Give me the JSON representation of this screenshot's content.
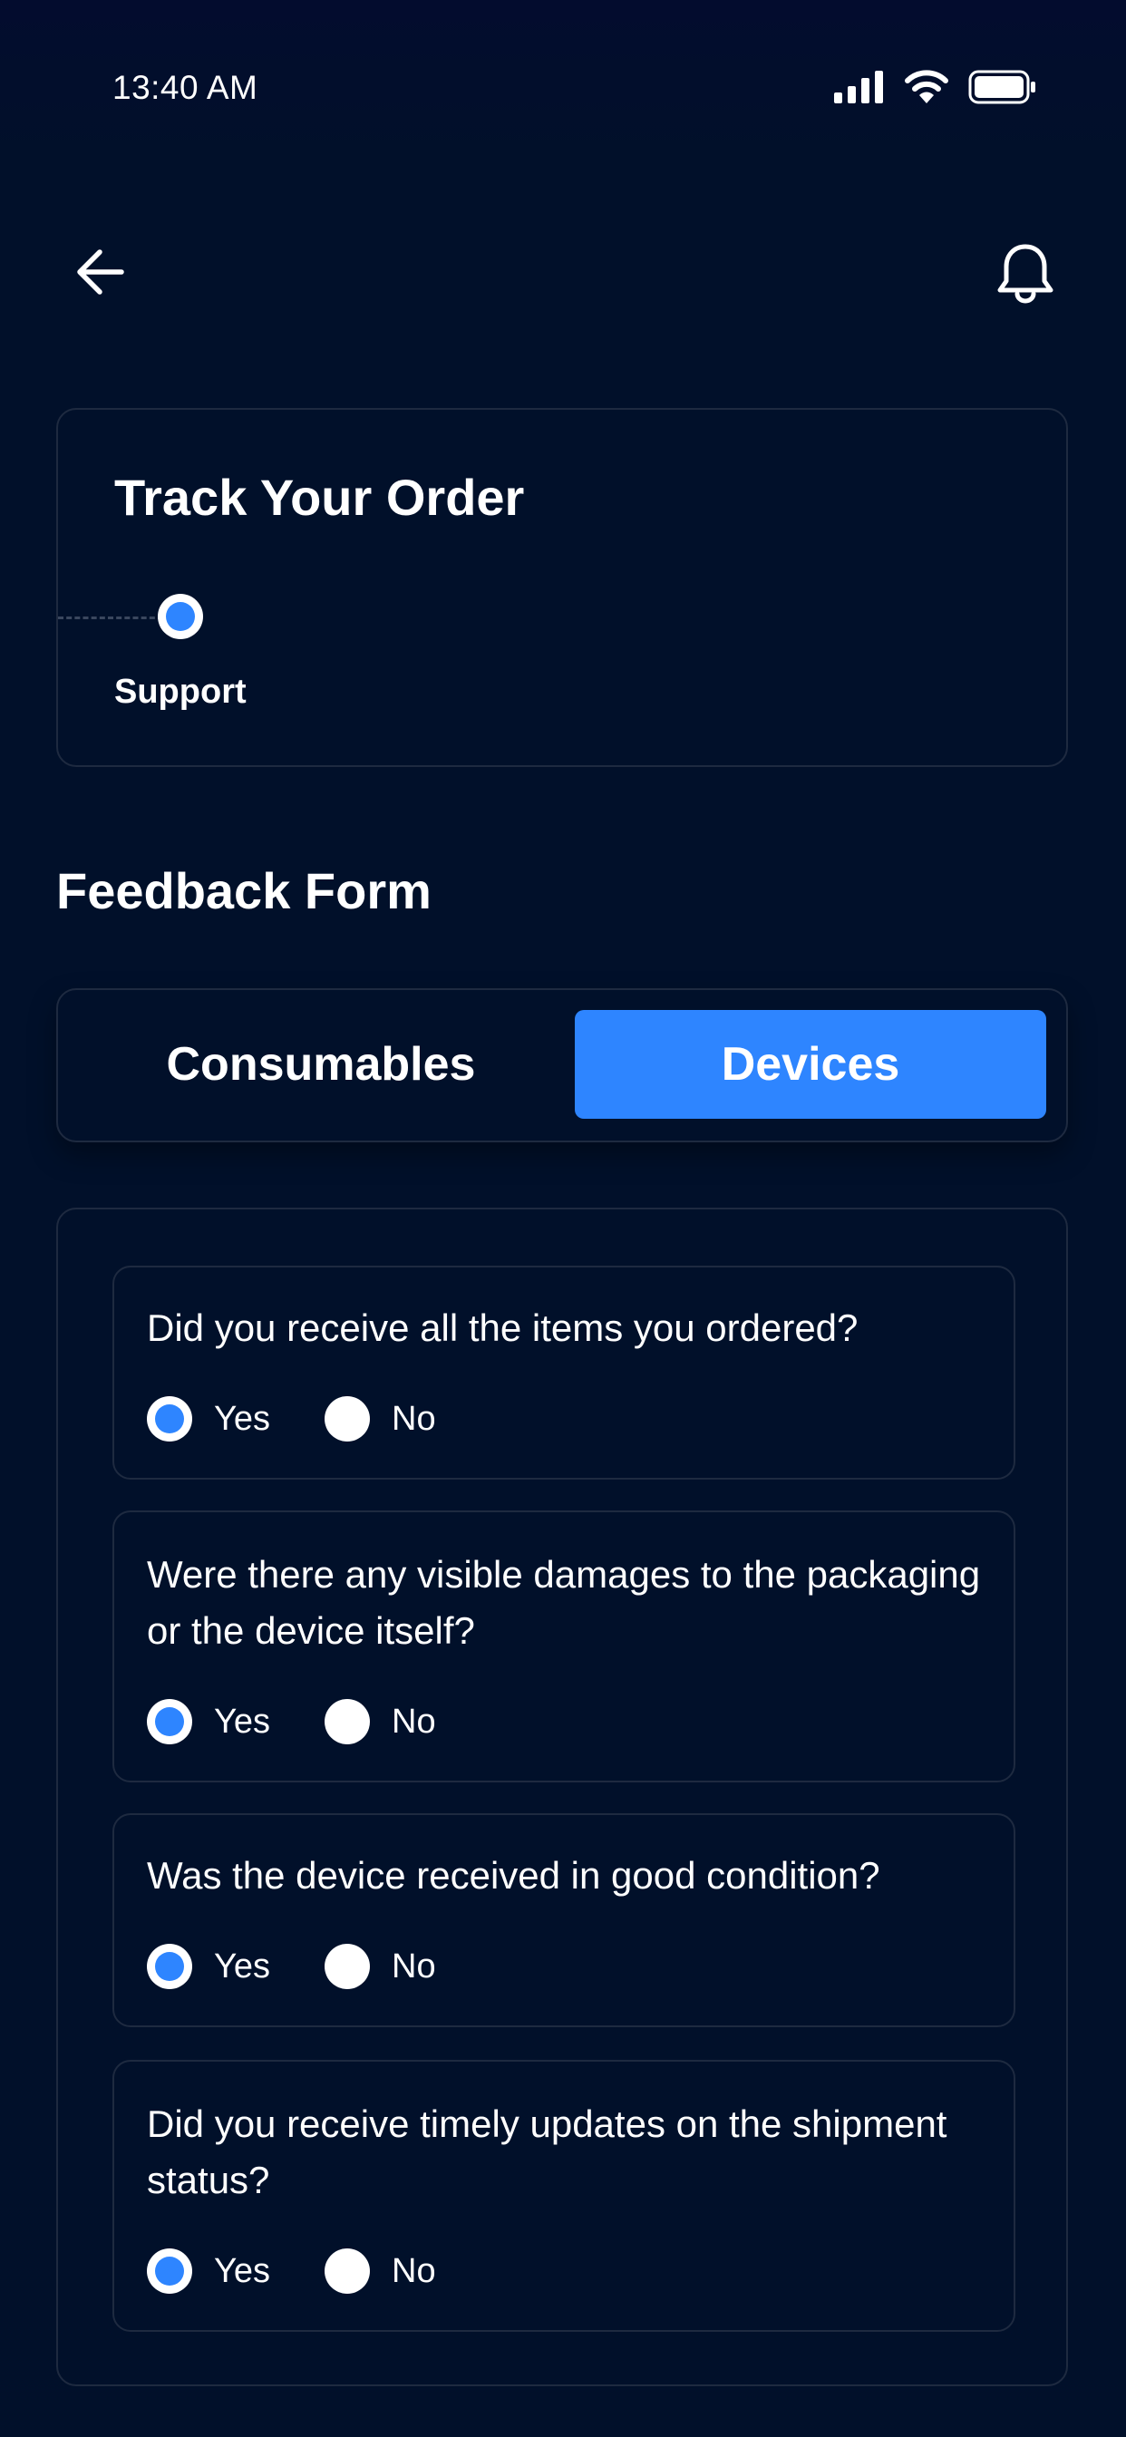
{
  "status_bar": {
    "time": "13:40 AM"
  },
  "header": {
    "back_icon": "arrow-left-icon",
    "notification_icon": "bell-icon"
  },
  "track": {
    "title": "Track Your Order",
    "step_label": "Support"
  },
  "feedback": {
    "title": "Feedback Form",
    "tabs": [
      {
        "label": "Consumables",
        "active": false
      },
      {
        "label": "Devices",
        "active": true
      }
    ],
    "questions": [
      {
        "text": "Did you receive all the items you ordered?",
        "options": [
          "Yes",
          "No"
        ],
        "selected": "Yes"
      },
      {
        "text": "Were there any visible damages to the packaging or the device itself?",
        "options": [
          "Yes",
          "No"
        ],
        "selected": "Yes"
      },
      {
        "text": "Was the device received in good condition?",
        "options": [
          "Yes",
          "No"
        ],
        "selected": "Yes"
      },
      {
        "text": "Did you receive timely updates on the shipment status?",
        "options": [
          "Yes",
          "No"
        ],
        "selected": "Yes"
      }
    ]
  },
  "colors": {
    "background": "#01102A",
    "accent": "#2E85FF",
    "border": "#1E2A40"
  }
}
